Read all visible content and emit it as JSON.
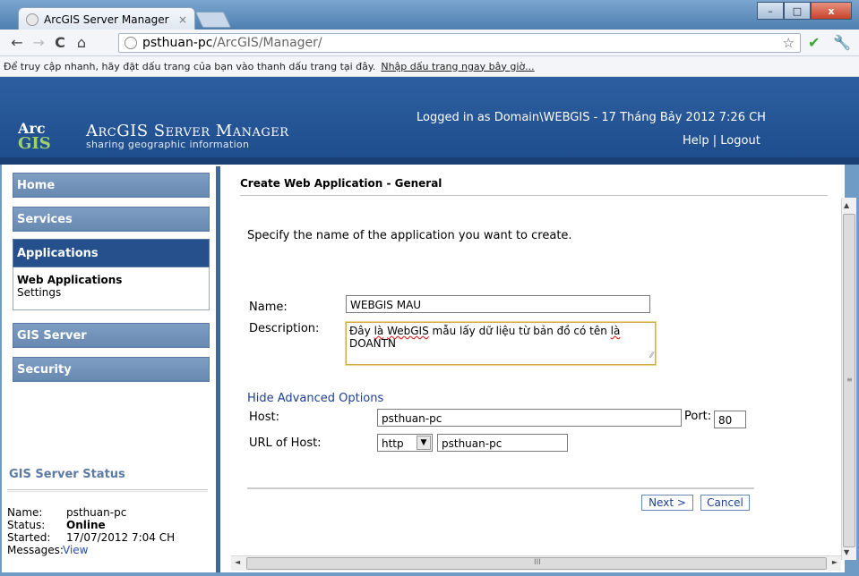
{
  "browser": {
    "tab_title": "ArcGIS Server Manager",
    "tab_close": "×",
    "window_buttons": [
      "–",
      "□",
      "x"
    ],
    "nav_back": "←",
    "nav_forward": "→",
    "reload": "C",
    "home": "⌂",
    "url_host": "psthuan-pc",
    "url_path": "/ArcGIS/Manager/",
    "bookmark_prompt": "Để truy cập nhanh, hãy đặt dấu trang của bạn vào thanh dấu trang tại đây.",
    "bookmark_link": "Nhập dấu trang ngay bây giờ..."
  },
  "header": {
    "logo_arc": "Arc",
    "logo_gis": "GIS",
    "brand_title": "ArcGIS Server Manager",
    "brand_tagline": "sharing geographic information",
    "logged_in": "Logged in as Domain\\WEBGIS - 17 Tháng Bảy 2012 7:26 CH",
    "help": "Help",
    "separator": " | ",
    "logout": "Logout"
  },
  "sidebar": {
    "items": [
      {
        "label": "Home"
      },
      {
        "label": "Services"
      },
      {
        "label": "Applications"
      },
      {
        "label": "GIS Server"
      },
      {
        "label": "Security"
      }
    ],
    "subitems": [
      "Web Applications",
      "Settings"
    ],
    "status": {
      "title": "GIS Server Status",
      "name_label": "Name:",
      "name_value": "psthuan-pc",
      "status_label": "Status:",
      "status_value": "Online",
      "started_label": "Started:",
      "started_value": "17/07/2012 7:04 CH",
      "messages_label": "Messages:",
      "messages_link": "View"
    }
  },
  "main": {
    "title": "Create Web Application - General",
    "intro": "Specify the name of the application you want to create.",
    "name_label": "Name:",
    "name_value": "WEBGIS MAU",
    "description_label": "Description:",
    "description_pre": "Đây ",
    "description_spell1": "là",
    "description_space": " ",
    "description_spell2": "WebGIS",
    "description_mid": " mẫu lấy dữ liệu từ bản đồ có tên ",
    "description_spell3": "là",
    "description_line2": "DOANTN",
    "advanced_link": "Hide Advanced Options",
    "host_label": "Host:",
    "host_value": "psthuan-pc",
    "port_label": "Port:",
    "port_value": "80",
    "url_host_label": "URL of Host:",
    "protocol_value": "http",
    "url_host_value": "psthuan-pc",
    "next_button": "Next >",
    "cancel_button": "Cancel"
  },
  "scrollbars": {
    "up": "▲",
    "down": "▼",
    "left": "◄",
    "right": "►",
    "grip_v": "≡",
    "grip_h": "III"
  }
}
